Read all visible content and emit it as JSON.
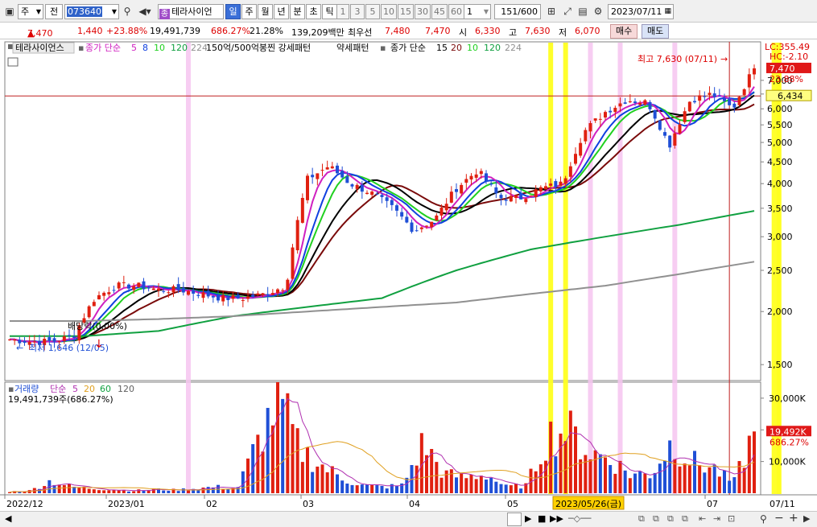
{
  "toolbar": {
    "market_select": "주",
    "prev_label": "전",
    "stock_code": "073640",
    "stock_name": "테라사이언",
    "periods": [
      "일",
      "주",
      "월",
      "년",
      "분",
      "초",
      "틱"
    ],
    "active_period": "일",
    "minute_steps": [
      "1",
      "3",
      "5",
      "10",
      "15",
      "30",
      "45",
      "60"
    ],
    "unit_value": "1",
    "count_display": "151",
    "count_total": "/600",
    "date": "2023/07/11"
  },
  "info": {
    "price": "7,470",
    "change": "1,440",
    "change_pct": "+23.88%",
    "volume": "19,491,739",
    "volume_ratio": "686.27%",
    "turnover": "21.28%",
    "amount": "139,209백만",
    "best_ask_label": "최우선",
    "best_ask": "7,480",
    "best_bid": "7,470",
    "open_label": "시",
    "open": "6,330",
    "high_label": "고",
    "high": "7,630",
    "low_label": "저",
    "low": "6,070",
    "buy_label": "매수",
    "sell_label": "매도"
  },
  "legend": {
    "stock_name": "테라사이언스",
    "ma_title": "종가 단순",
    "ma_periods": [
      "5",
      "8",
      "10",
      "120",
      "224"
    ],
    "pattern_strong": "150억/500억봉찐 강세패턴",
    "pattern_weak": "약세패턴",
    "ma2_title": "종가 단순",
    "ma2_periods": [
      "15",
      "20",
      "10",
      "120",
      "224"
    ]
  },
  "price_axis": {
    "lc_label": "LC:355.49",
    "hc_label": "HC:-2.10",
    "last_price": "7,470",
    "last_pct": "23.88%",
    "cross_price": "6,434",
    "ticks": [
      "7,000",
      "6,500",
      "6,000",
      "5,500",
      "5,000",
      "4,500",
      "4,000",
      "3,500",
      "3,000",
      "2,500",
      "2,000",
      "1,500"
    ]
  },
  "annotations": {
    "high_text": "최고 7,630 (07/11)",
    "low_text": "최저 1,646 (12/05)",
    "dividend_text": "배당락(0.00%)"
  },
  "volume_panel": {
    "title": "거래량",
    "ma_title": "단순",
    "ma_periods": [
      "5",
      "20",
      "60",
      "120"
    ],
    "volume_text": "19,491,739주(686.27%)",
    "last_volume": "19,492K",
    "last_pct": "686.27%",
    "ticks": [
      "30,000K",
      "20,000K",
      "10,000K"
    ]
  },
  "x_axis": {
    "labels": [
      "2022/12",
      "2023/01",
      "02",
      "03",
      "04",
      "05",
      "06",
      "07"
    ],
    "cursor_label": "2023/05/26(금)",
    "right_label": "07/11"
  },
  "colors": {
    "up": "#e02010",
    "down": "#1f4fd6",
    "ma5": "#d020c0",
    "ma8": "#1040e0",
    "ma10": "#20d020",
    "ma120": "#10a040",
    "ma224": "#909090",
    "highlight_yellow": "#ffff20",
    "highlight_pink": "#f6c4f0"
  },
  "chart_data": [
    {
      "type": "candlestick",
      "title": "테라사이언스",
      "y_scale": "log",
      "ylim": [
        1400,
        7700
      ],
      "x": [
        "2022/12",
        "2023/01",
        "02",
        "03",
        "04",
        "05",
        "06",
        "07/11"
      ],
      "series": [
        {
          "name": "종가",
          "values": [
            1720,
            1700,
            1700,
            1750,
            2150,
            2300,
            2300,
            2250,
            2250,
            2200,
            2150,
            2150,
            2200,
            2300,
            4100,
            4400,
            4000,
            3800,
            3500,
            3100,
            3300,
            3900,
            4300,
            3700,
            3700,
            3900,
            4000,
            5300,
            5900,
            6300,
            6200,
            4900,
            6300,
            6500,
            6000,
            7470
          ]
        },
        {
          "name": "120",
          "values": [
            1750,
            1750,
            1800,
            1950,
            2050,
            2150,
            2500,
            2800,
            3000,
            3200,
            3450
          ]
        },
        {
          "name": "224",
          "values": [
            1900,
            1900,
            1920,
            1950,
            2000,
            2050,
            2100,
            2200,
            2300,
            2450,
            2620
          ]
        }
      ],
      "annotations": [
        "최고 7,630 (07/11)",
        "최저 1,646 (12/05)",
        "배당락(0.00%)"
      ]
    },
    {
      "type": "bar",
      "title": "거래량",
      "ylim": [
        0,
        32000
      ],
      "unit": "K",
      "x": [
        "2022/12",
        "2023/01",
        "02",
        "03",
        "04",
        "05",
        "06",
        "07/11"
      ],
      "values": [
        500,
        800,
        4000,
        2000,
        1500,
        1200,
        800,
        1200,
        1000,
        1500,
        2000,
        1500,
        16000,
        30000,
        14000,
        9000,
        5000,
        2500,
        2000,
        2500,
        16000,
        6000,
        5000,
        6000,
        2000,
        2500,
        18000,
        20000,
        13000,
        11000,
        6000,
        6000,
        16000,
        10000,
        8000,
        3000,
        19492
      ]
    }
  ]
}
